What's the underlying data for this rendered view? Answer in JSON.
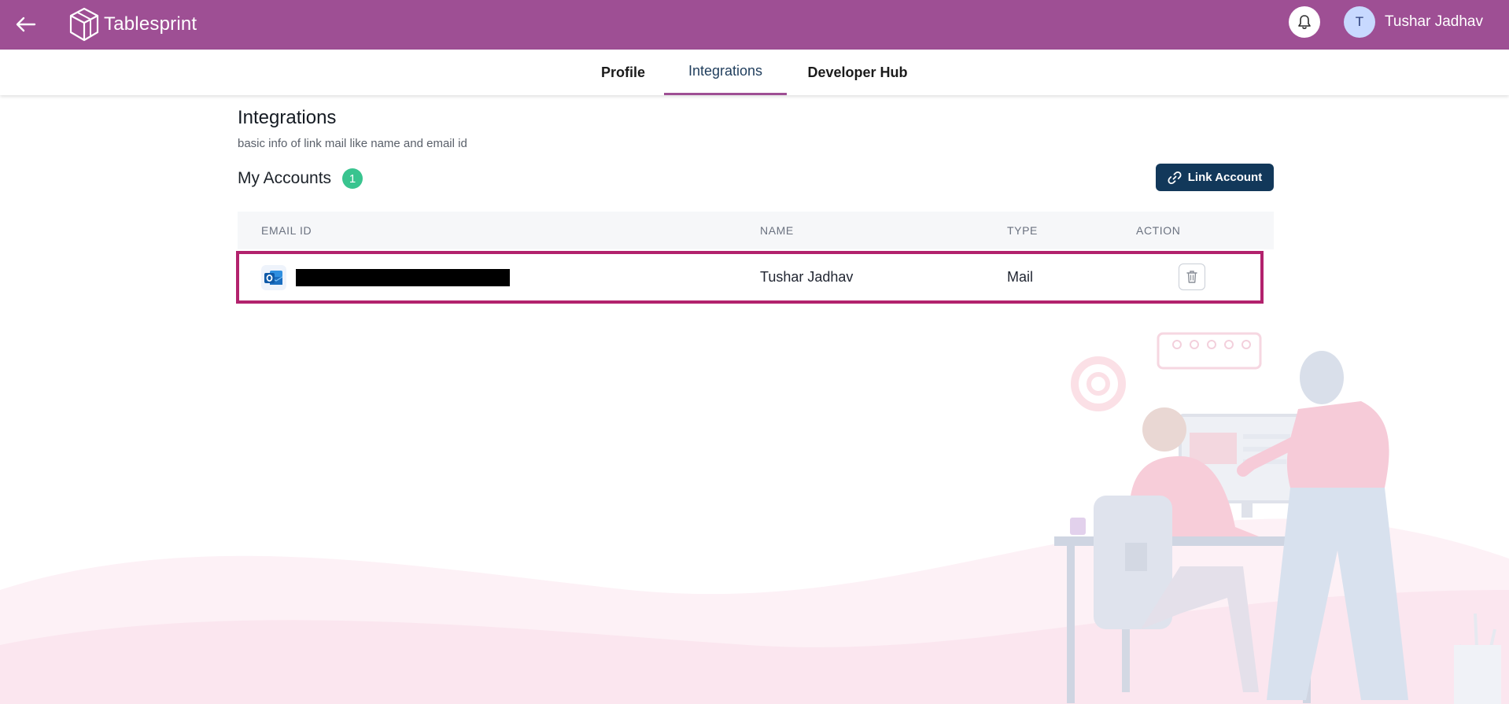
{
  "header": {
    "app_name": "Tablesprint",
    "user": {
      "initial": "T",
      "name": "Tushar Jadhav"
    }
  },
  "tabs": [
    {
      "label": "Profile",
      "active": false
    },
    {
      "label": "Integrations",
      "active": true
    },
    {
      "label": "Developer Hub",
      "active": false
    }
  ],
  "page": {
    "title": "Integrations",
    "subtitle": "basic info of link mail like name and email id"
  },
  "accounts": {
    "title": "My Accounts",
    "count": "1",
    "link_button_label": "Link Account"
  },
  "table": {
    "columns": [
      "EMAIL ID",
      "NAME",
      "TYPE",
      "ACTION"
    ],
    "rows": [
      {
        "email": "",
        "name": "Tushar Jadhav",
        "type": "Mail",
        "provider_icon": "outlook-icon"
      }
    ]
  },
  "colors": {
    "header_bg": "#9e4f94",
    "primary_button": "#12385a",
    "badge": "#39c48f",
    "highlight_border": "#b2226d"
  }
}
